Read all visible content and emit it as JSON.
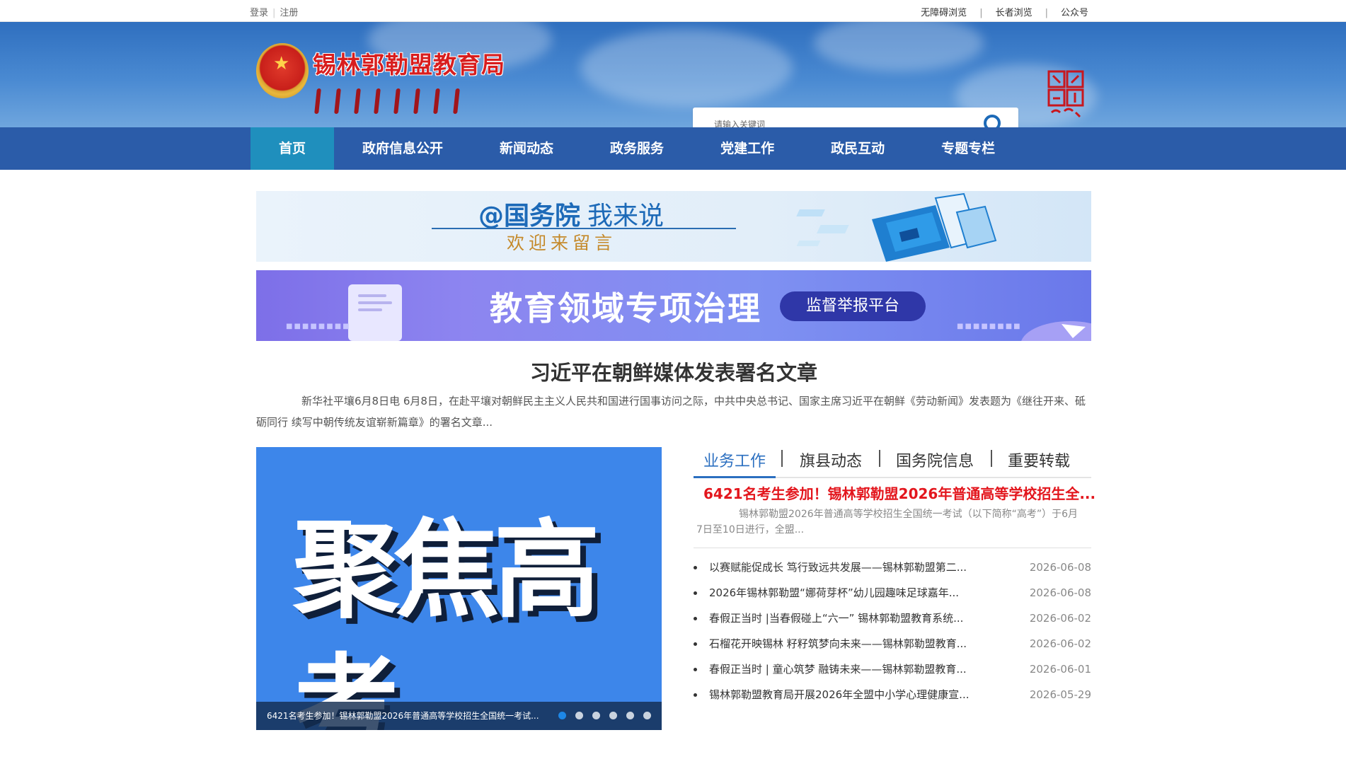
{
  "topbar": {
    "login": "登录",
    "register": "注册",
    "accessible": "无障碍浏览",
    "elder": "长者浏览",
    "official_account": "公众号"
  },
  "header": {
    "site_title": "锡林郭勒盟教育局",
    "search_placeholder": "请输入关键词",
    "brand_color": "#2b5ca9",
    "emblem_icon": "national-emblem-icon",
    "seal_icon": "red-seal-icon"
  },
  "nav": {
    "items": [
      {
        "label": "首页",
        "active": true
      },
      {
        "label": "政府信息公开",
        "active": false
      },
      {
        "label": "新闻动态",
        "active": false
      },
      {
        "label": "政务服务",
        "active": false
      },
      {
        "label": "党建工作",
        "active": false
      },
      {
        "label": "政民互动",
        "active": false
      },
      {
        "label": "专题专栏",
        "active": false
      }
    ]
  },
  "banners": {
    "b1_title_bold": "@国务院",
    "b1_title_light": "我来说",
    "b1_subtitle": "欢迎来留言",
    "b2_title": "教育领域专项治理",
    "b2_button": "监督举报平台"
  },
  "headline": {
    "title": "习近平在朝鲜媒体发表署名文章",
    "summary": "新华社平壤6月8日电 6月8日，在赴平壤对朝鲜民主主义人民共和国进行国事访问之际，中共中央总书记、国家主席习近平在朝鲜《劳动新闻》发表题为《继往开来、砥砺同行 续写中朝传统友谊崭新篇章》的署名文章..."
  },
  "slider": {
    "image_text": "聚焦高考",
    "caption": "6421名考生参加！锡林郭勒盟2026年普通高等学校招生全国统一考试...",
    "dot_count": 6,
    "active_dot": 1
  },
  "news": {
    "tabs": [
      "业务工作",
      "旗县动态",
      "国务院信息",
      "重要转载"
    ],
    "active_tab": 0,
    "lead_title": "6421名考生参加！锡林郭勒盟2026年普通高等学校招生全...",
    "lead_summary": "锡林郭勒盟2026年普通高等学校招生全国统一考试（以下简称“高考”）于6月7日至10日进行，全盟...",
    "items": [
      {
        "title": "以赛赋能促成长 笃行致远共发展——锡林郭勒盟第二...",
        "date": "2026-06-08"
      },
      {
        "title": "2026年锡林郭勒盟“娜荷芽杯”幼儿园趣味足球嘉年...",
        "date": "2026-06-08"
      },
      {
        "title": "春假正当时 |当春假碰上“六一” 锡林郭勒盟教育系统...",
        "date": "2026-06-02"
      },
      {
        "title": "石榴花开映锡林 籽籽筑梦向未来——锡林郭勒盟教育...",
        "date": "2026-06-02"
      },
      {
        "title": "春假正当时 | 童心筑梦 融铸未来——锡林郭勒盟教育...",
        "date": "2026-06-01"
      },
      {
        "title": "锡林郭勒盟教育局开展2026年全盟中小学心理健康宣...",
        "date": "2026-05-29"
      }
    ]
  }
}
